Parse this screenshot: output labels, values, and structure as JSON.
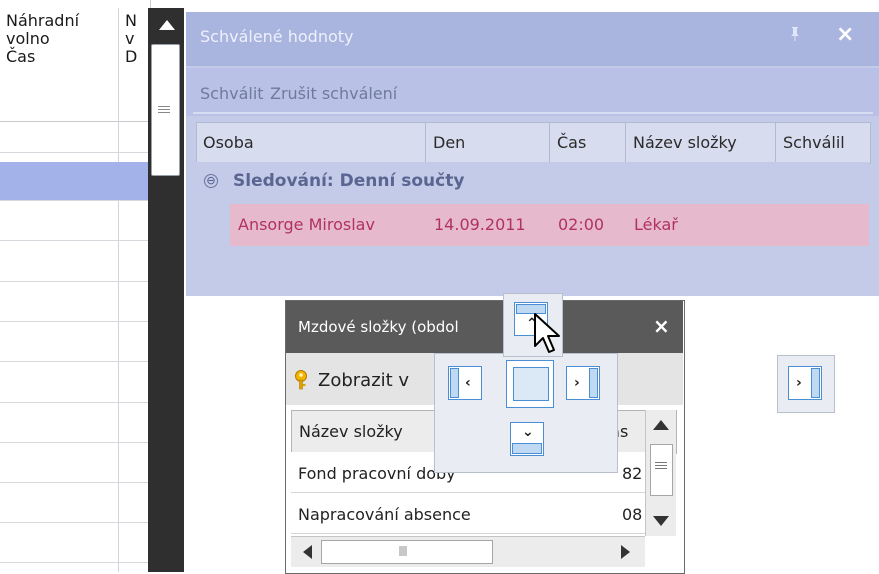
{
  "left_grid": {
    "col1_header": "Náhradní\nvolno\nČas",
    "col2_header": "N\nv\nD"
  },
  "panel": {
    "title": "Schválené hodnoty",
    "pin_icon": "pin-icon",
    "close_label": "×",
    "toolbar": {
      "approve": "Schválit",
      "cancel_approval": "Zrušit schválení"
    },
    "columns": [
      "Osoba",
      "Den",
      "Čas",
      "Název složky",
      "Schválil"
    ],
    "group": {
      "toggle": "⊖",
      "label": "Sledování: Denní součty"
    },
    "rows": [
      {
        "osoba": "Ansorge Miroslav",
        "den": "14.09.2011",
        "cas": "02:00",
        "nazev": "Lékař",
        "schvalil": ""
      }
    ]
  },
  "float_window": {
    "title": "Mzdové složky (obdol",
    "close_label": "×",
    "toolbar_button": "Zobrazit v",
    "columns": [
      "Název složky",
      "Čas"
    ],
    "rows": [
      {
        "nazev": "Fond pracovní doby",
        "cas": "82"
      },
      {
        "nazev": "Napracování absence",
        "cas": "08"
      }
    ]
  },
  "colors": {
    "panel_bg": "#c3cbe8",
    "panel_title_bg": "#a9b4df",
    "selected_row": "#e7b9cd",
    "selected_text": "#b0335f",
    "float_title_bg": "#5a5a5a",
    "dock_accent": "#4a8fd6"
  }
}
